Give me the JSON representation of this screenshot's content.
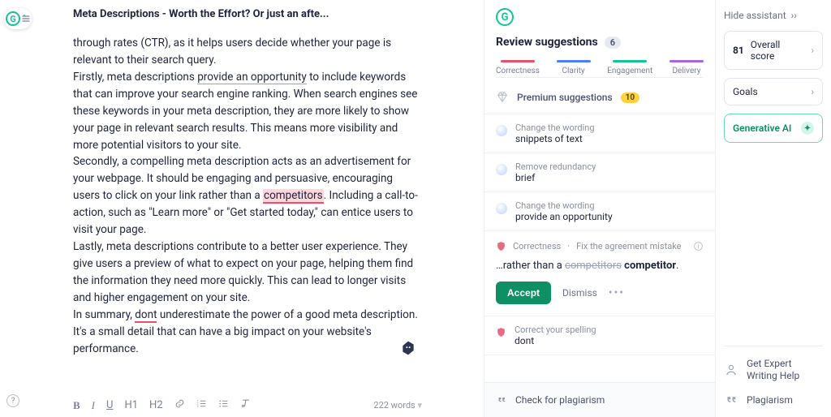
{
  "doc": {
    "title": "Meta Descriptions - Worth the Effort? Or just an afte...",
    "p1a": "through rates (CTR), as it helps users decide whether your page is relevant to their search query.",
    "p2a": "Firstly, meta descriptions ",
    "p2_ul": "provide an opportunity",
    "p2b": " to include keywords that can improve your search engine ranking. When search engines see these keywords in your meta description, they are more likely to show your page in relevant search results. This means more visibility and more potential visitors to your site.",
    "p3a": "Secondly, a compelling meta description acts as an advertisement for your webpage. It should be engaging and persuasive, encouraging users to click on your link rather than a ",
    "p3_hl": "competitors",
    "p3b": ". Including a call-to-action, such as \"Learn more\" or \"Get started today,\" can entice users to visit your page.",
    "p4": "Lastly, meta descriptions contribute to a better user experience. They give users a preview of what to expect on your page, helping them find the information they need more quickly. This can lead to longer visits and higher engagement on your site.",
    "p5a": "In summary, ",
    "p5_err": "dont",
    "p5b": " underestimate the power of a good meta description. It's a small detail that can have a big impact on your website's performance."
  },
  "toolbar": {
    "bold": "B",
    "italic": "I",
    "underline": "U",
    "h1": "H1",
    "h2": "H2",
    "word_count": "222 words"
  },
  "panel": {
    "title": "Review suggestions",
    "count": "6",
    "tabs": {
      "correctness": "Correctness",
      "clarity": "Clarity",
      "engagement": "Engagement",
      "delivery": "Delivery"
    },
    "premium": {
      "label": "Premium suggestions",
      "count": "10"
    },
    "sug1": {
      "lbl": "Change the wording",
      "val": "snippets of text"
    },
    "sug2": {
      "lbl": "Remove redundancy",
      "val": "brief"
    },
    "sug3": {
      "lbl": "Change the wording",
      "val": "provide an opportunity"
    },
    "expanded": {
      "cat": "Correctness",
      "rule": "Fix the agreement mistake",
      "pre": "…rather than a ",
      "strike": "competitors",
      "bold": "competitor",
      "post": ".",
      "accept": "Accept",
      "dismiss": "Dismiss"
    },
    "spell": {
      "lbl": "Correct your spelling",
      "val": "dont"
    },
    "plagiarism": "Check for plagiarism"
  },
  "rail": {
    "hide": "Hide assistant",
    "score_num": "81",
    "score_lbl": "Overall score",
    "goals": "Goals",
    "gen_ai": "Generative AI",
    "expert": "Get Expert Writing Help",
    "plag": "Plagiarism"
  }
}
